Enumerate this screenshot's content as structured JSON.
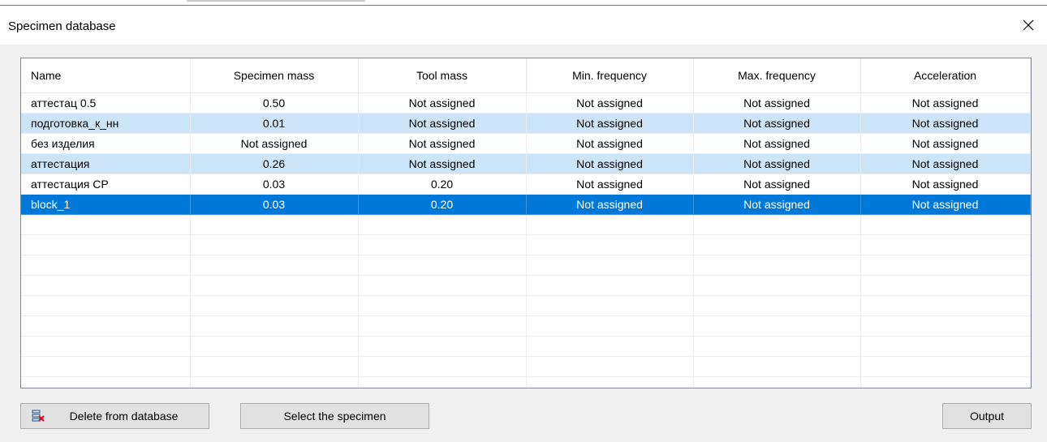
{
  "window": {
    "title": "Specimen database"
  },
  "grid": {
    "columns": [
      "Name",
      "Specimen mass",
      "Tool mass",
      "Min. frequency",
      "Max. frequency",
      "Acceleration"
    ],
    "rows": [
      {
        "cells": [
          "аттестац 0.5",
          "0.50",
          "Not assigned",
          "Not assigned",
          "Not assigned",
          "Not assigned"
        ],
        "state": "normal"
      },
      {
        "cells": [
          "подготовка_к_нн",
          "0.01",
          "Not assigned",
          "Not assigned",
          "Not assigned",
          "Not assigned"
        ],
        "state": "alt"
      },
      {
        "cells": [
          "без изделия",
          "Not assigned",
          "Not assigned",
          "Not assigned",
          "Not assigned",
          "Not assigned"
        ],
        "state": "normal"
      },
      {
        "cells": [
          "аттестация",
          "0.26",
          "Not assigned",
          "Not assigned",
          "Not assigned",
          "Not assigned"
        ],
        "state": "alt"
      },
      {
        "cells": [
          "аттестация СР",
          "0.03",
          "0.20",
          "Not assigned",
          "Not assigned",
          "Not assigned"
        ],
        "state": "normal"
      },
      {
        "cells": [
          "block_1",
          "0.03",
          "0.20",
          "Not assigned",
          "Not assigned",
          "Not assigned"
        ],
        "state": "selected"
      }
    ]
  },
  "buttons": {
    "delete": "Delete from database",
    "select": "Select the specimen",
    "output": "Output"
  },
  "icons": {
    "close": "close-icon",
    "delete": "delete-record-icon"
  },
  "colors": {
    "selected_row": "#0078d7",
    "alt_row": "#cce4f7",
    "dialog_bg": "#f0f0f0"
  }
}
